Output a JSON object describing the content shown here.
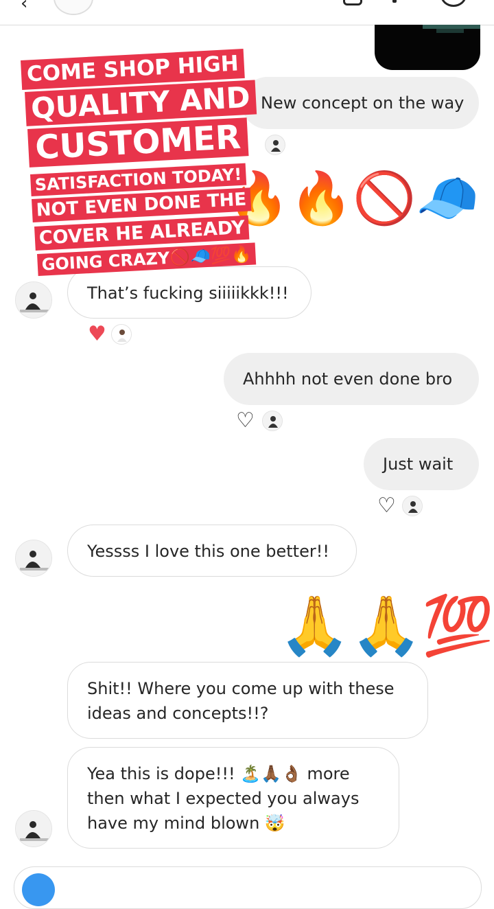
{
  "header": {
    "back_icon": "chevron-left-icon",
    "video_icon": "video-call-icon",
    "info_icon": "info-icon",
    "extra_icon": "phone-icon"
  },
  "promo_sticker": {
    "line1": "COME SHOP HIGH",
    "line2": "QUALITY AND",
    "line3": "CUSTOMER",
    "line4": "SATISFACTION TODAY!",
    "line5": "NOT EVEN DONE THE",
    "line6": "COVER HE ALREADY",
    "line7": "GOING CRAZY🚫🧢💯🔥",
    "color": "#e8344b"
  },
  "messages": [
    {
      "id": "m1",
      "side": "sent",
      "text": "New concept on the way"
    },
    {
      "id": "m2",
      "side": "sent",
      "text": "🔥🔥🚫🧢"
    },
    {
      "id": "m3",
      "side": "received",
      "text": "That’s fucking siiiiikkk!!!"
    },
    {
      "id": "m4",
      "side": "sent",
      "text": "Ahhhh not even done bro"
    },
    {
      "id": "m5",
      "side": "sent",
      "text": "Just wait"
    },
    {
      "id": "m6",
      "side": "received",
      "text": "Yessss I love this one better!!"
    },
    {
      "id": "m7",
      "side": "sent",
      "text": "🙏🙏💯"
    },
    {
      "id": "m8",
      "side": "received",
      "text": "Shit!! Where you come up with these ideas and concepts!!?"
    },
    {
      "id": "m9",
      "side": "received",
      "text": "Yea this is dope!!! 🏝️🙏🏾👌🏾 more then what I expected you always have my mind blown 🤯"
    }
  ],
  "reactions": {
    "heart_liked": "♥",
    "heart_empty": "♡"
  },
  "colors": {
    "sent_bubble": "#efefef",
    "received_border": "#dbdbdb",
    "like_red": "#ed4956",
    "accent_blue": "#3897f0"
  }
}
